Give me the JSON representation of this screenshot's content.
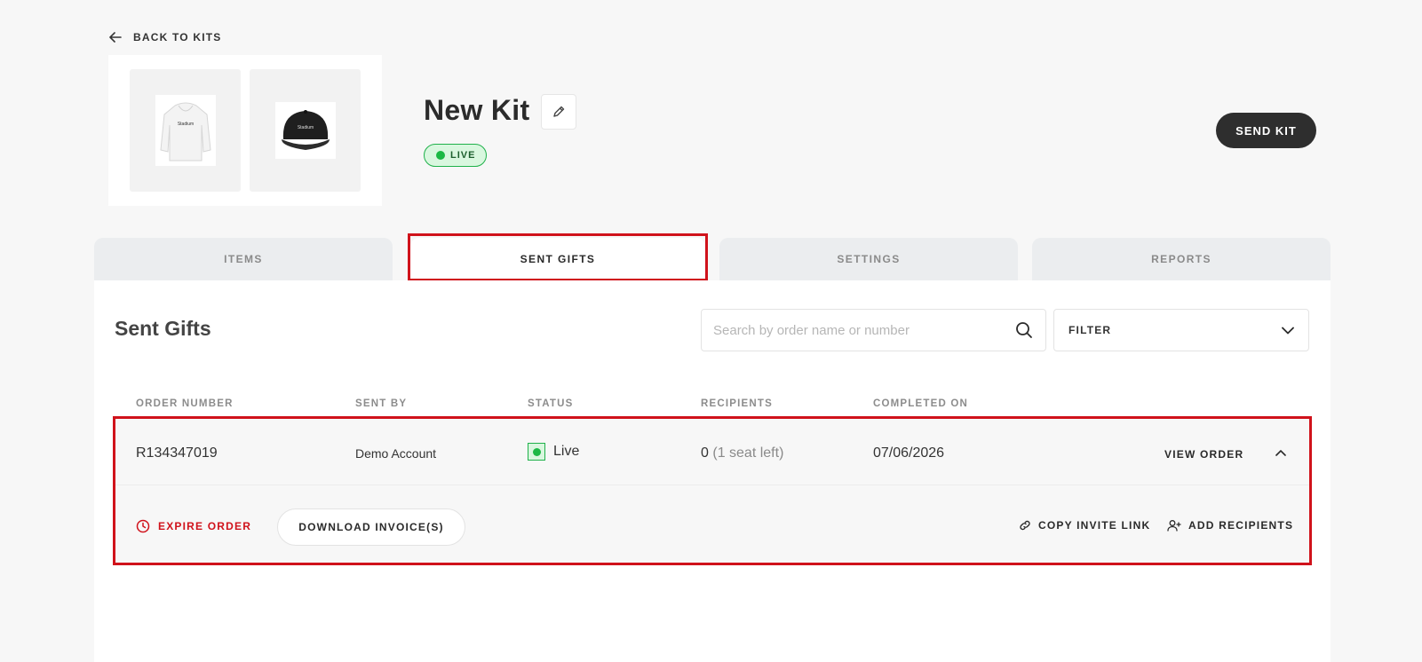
{
  "header": {
    "back_label": "BACK TO KITS",
    "kit_title": "New Kit",
    "status_badge": "LIVE",
    "send_button": "SEND KIT"
  },
  "kit_images": [
    {
      "name": "hoodie",
      "brand_text": "Stadium"
    },
    {
      "name": "cap",
      "brand_text": "Stadium"
    }
  ],
  "tabs": [
    {
      "label": "ITEMS",
      "active": false
    },
    {
      "label": "SENT GIFTS",
      "active": true
    },
    {
      "label": "SETTINGS",
      "active": false
    },
    {
      "label": "REPORTS",
      "active": false
    }
  ],
  "sent_gifts": {
    "title": "Sent Gifts",
    "search_placeholder": "Search by order name or number",
    "filter_label": "FILTER",
    "columns": [
      "ORDER NUMBER",
      "SENT BY",
      "STATUS",
      "RECIPIENTS",
      "COMPLETED ON"
    ],
    "rows": [
      {
        "order_number": "R134347019",
        "sent_by": "Demo Account",
        "status": "Live",
        "recipients_count": "0",
        "seats_left": "(1 seat left)",
        "completed_on": "07/06/2026",
        "view_order": "VIEW ORDER",
        "actions": {
          "expire": "EXPIRE ORDER",
          "download": "DOWNLOAD INVOICE(S)",
          "copy_link": "COPY INVITE LINK",
          "add_recipients": "ADD RECIPIENTS"
        }
      }
    ]
  },
  "colors": {
    "accent_dark": "#2e2e2e",
    "live_green": "#1cb845",
    "highlight_red": "#d0121b"
  }
}
